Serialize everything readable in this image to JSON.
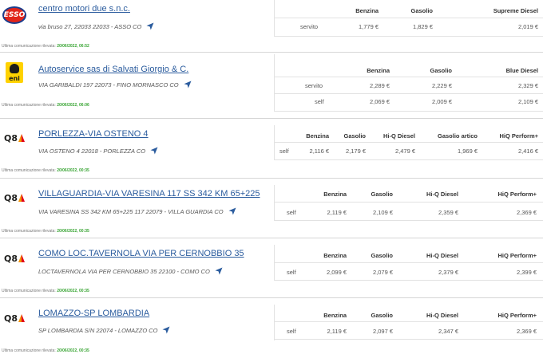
{
  "stations": [
    {
      "brand": "ESSO",
      "logo_icon": "esso-logo-icon",
      "name": "centro motori due s.n.c.",
      "address": "via bruso 27, 22033 22033 - ASSO CO",
      "comm_label": "Ultima comunicazione rilevata:",
      "comm_date": "20/06/2022, 06:52",
      "headers": [
        "Benzina",
        "Gasolio",
        "Supreme Diesel"
      ],
      "rows": [
        {
          "service": "servito",
          "prices": [
            "1,779 €",
            "1,829 €",
            "2,019 €"
          ]
        }
      ]
    },
    {
      "brand": "eni",
      "logo_icon": "eni-logo-icon",
      "name": "Autoservice sas di Salvati Giorgio & C.",
      "address": "VIA GARIBALDI 197 22073 - FINO MORNASCO CO",
      "comm_label": "Ultima comunicazione rilevata:",
      "comm_date": "20/06/2022, 06:06",
      "headers": [
        "Benzina",
        "Gasolio",
        "Blue Diesel"
      ],
      "rows": [
        {
          "service": "servito",
          "prices": [
            "2,289 €",
            "2,229 €",
            "2,329 €"
          ]
        },
        {
          "service": "self",
          "prices": [
            "2,069 €",
            "2,009 €",
            "2,109 €"
          ]
        }
      ]
    },
    {
      "brand": "Q8",
      "logo_icon": "q8-logo-icon",
      "name": "PORLEZZA-VIA OSTENO 4",
      "address": "VIA OSTENO 4 22018 - PORLEZZA CO",
      "comm_label": "Ultima comunicazione rilevata:",
      "comm_date": "20/06/2022, 00:35",
      "headers": [
        "Benzina",
        "Gasolio",
        "Hi-Q Diesel",
        "Gasolio artico",
        "HiQ Perform+"
      ],
      "rows": [
        {
          "service": "self",
          "prices": [
            "2,116 €",
            "2,179 €",
            "2,479 €",
            "1,969 €",
            "2,416 €"
          ]
        }
      ]
    },
    {
      "brand": "Q8",
      "logo_icon": "q8-logo-icon",
      "name": "VILLAGUARDIA-VIA VARESINA 117 SS 342 KM 65+225",
      "address": "VIA VARESINA SS 342 KM 65+225 117 22079 - VILLA GUARDIA CO",
      "comm_label": "Ultima comunicazione rilevata:",
      "comm_date": "20/06/2022, 00:35",
      "headers": [
        "Benzina",
        "Gasolio",
        "Hi-Q Diesel",
        "HiQ Perform+"
      ],
      "rows": [
        {
          "service": "self",
          "prices": [
            "2,119 €",
            "2,109 €",
            "2,359 €",
            "2,369 €"
          ]
        }
      ]
    },
    {
      "brand": "Q8",
      "logo_icon": "q8-logo-icon",
      "name": "COMO LOC.TAVERNOLA VIA PER CERNOBBIO 35",
      "address": "LOCTAVERNOLA VIA PER CERNOBBIO 35 22100 - COMO CO",
      "comm_label": "Ultima comunicazione rilevata:",
      "comm_date": "20/06/2022, 00:35",
      "headers": [
        "Benzina",
        "Gasolio",
        "Hi-Q Diesel",
        "HiQ Perform+"
      ],
      "rows": [
        {
          "service": "self",
          "prices": [
            "2,099 €",
            "2,079 €",
            "2,379 €",
            "2,399 €"
          ]
        }
      ]
    },
    {
      "brand": "Q8",
      "logo_icon": "q8-logo-icon",
      "name": "LOMAZZO-SP LOMBARDIA",
      "address": "SP LOMBARDIA S/N 22074 - LOMAZZO CO",
      "comm_label": "Ultima comunicazione rilevata:",
      "comm_date": "20/06/2022, 00:35",
      "headers": [
        "Benzina",
        "Gasolio",
        "Hi-Q Diesel",
        "HiQ Perform+"
      ],
      "rows": [
        {
          "service": "self",
          "prices": [
            "2,119 €",
            "2,097 €",
            "2,347 €",
            "2,369 €"
          ]
        }
      ]
    }
  ]
}
